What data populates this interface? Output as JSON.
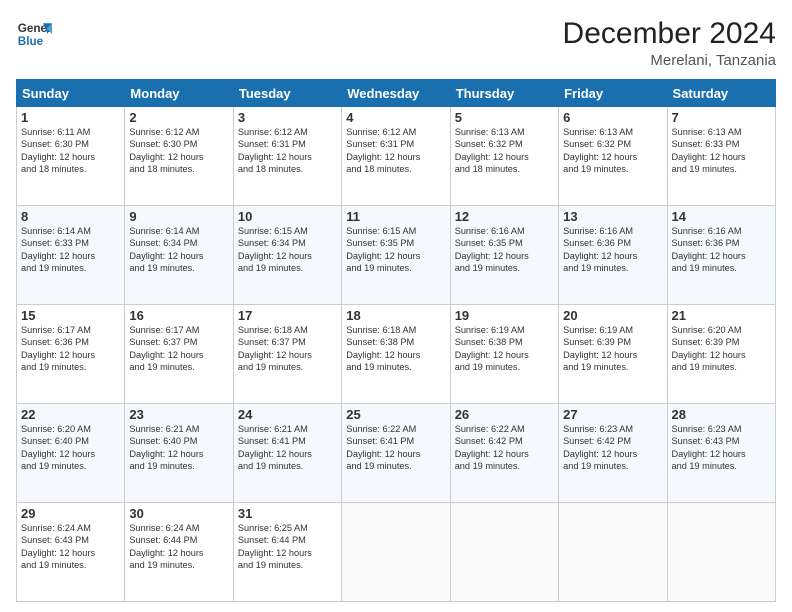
{
  "logo": {
    "line1": "General",
    "line2": "Blue"
  },
  "title": "December 2024",
  "subtitle": "Merelani, Tanzania",
  "days_header": [
    "Sunday",
    "Monday",
    "Tuesday",
    "Wednesday",
    "Thursday",
    "Friday",
    "Saturday"
  ],
  "weeks": [
    [
      {
        "day": "1",
        "sunrise": "6:11 AM",
        "sunset": "6:30 PM",
        "daylight": "12 hours and 18 minutes."
      },
      {
        "day": "2",
        "sunrise": "6:12 AM",
        "sunset": "6:30 PM",
        "daylight": "12 hours and 18 minutes."
      },
      {
        "day": "3",
        "sunrise": "6:12 AM",
        "sunset": "6:31 PM",
        "daylight": "12 hours and 18 minutes."
      },
      {
        "day": "4",
        "sunrise": "6:12 AM",
        "sunset": "6:31 PM",
        "daylight": "12 hours and 18 minutes."
      },
      {
        "day": "5",
        "sunrise": "6:13 AM",
        "sunset": "6:32 PM",
        "daylight": "12 hours and 18 minutes."
      },
      {
        "day": "6",
        "sunrise": "6:13 AM",
        "sunset": "6:32 PM",
        "daylight": "12 hours and 19 minutes."
      },
      {
        "day": "7",
        "sunrise": "6:13 AM",
        "sunset": "6:33 PM",
        "daylight": "12 hours and 19 minutes."
      }
    ],
    [
      {
        "day": "8",
        "sunrise": "6:14 AM",
        "sunset": "6:33 PM",
        "daylight": "12 hours and 19 minutes."
      },
      {
        "day": "9",
        "sunrise": "6:14 AM",
        "sunset": "6:34 PM",
        "daylight": "12 hours and 19 minutes."
      },
      {
        "day": "10",
        "sunrise": "6:15 AM",
        "sunset": "6:34 PM",
        "daylight": "12 hours and 19 minutes."
      },
      {
        "day": "11",
        "sunrise": "6:15 AM",
        "sunset": "6:35 PM",
        "daylight": "12 hours and 19 minutes."
      },
      {
        "day": "12",
        "sunrise": "6:16 AM",
        "sunset": "6:35 PM",
        "daylight": "12 hours and 19 minutes."
      },
      {
        "day": "13",
        "sunrise": "6:16 AM",
        "sunset": "6:36 PM",
        "daylight": "12 hours and 19 minutes."
      },
      {
        "day": "14",
        "sunrise": "6:16 AM",
        "sunset": "6:36 PM",
        "daylight": "12 hours and 19 minutes."
      }
    ],
    [
      {
        "day": "15",
        "sunrise": "6:17 AM",
        "sunset": "6:36 PM",
        "daylight": "12 hours and 19 minutes."
      },
      {
        "day": "16",
        "sunrise": "6:17 AM",
        "sunset": "6:37 PM",
        "daylight": "12 hours and 19 minutes."
      },
      {
        "day": "17",
        "sunrise": "6:18 AM",
        "sunset": "6:37 PM",
        "daylight": "12 hours and 19 minutes."
      },
      {
        "day": "18",
        "sunrise": "6:18 AM",
        "sunset": "6:38 PM",
        "daylight": "12 hours and 19 minutes."
      },
      {
        "day": "19",
        "sunrise": "6:19 AM",
        "sunset": "6:38 PM",
        "daylight": "12 hours and 19 minutes."
      },
      {
        "day": "20",
        "sunrise": "6:19 AM",
        "sunset": "6:39 PM",
        "daylight": "12 hours and 19 minutes."
      },
      {
        "day": "21",
        "sunrise": "6:20 AM",
        "sunset": "6:39 PM",
        "daylight": "12 hours and 19 minutes."
      }
    ],
    [
      {
        "day": "22",
        "sunrise": "6:20 AM",
        "sunset": "6:40 PM",
        "daylight": "12 hours and 19 minutes."
      },
      {
        "day": "23",
        "sunrise": "6:21 AM",
        "sunset": "6:40 PM",
        "daylight": "12 hours and 19 minutes."
      },
      {
        "day": "24",
        "sunrise": "6:21 AM",
        "sunset": "6:41 PM",
        "daylight": "12 hours and 19 minutes."
      },
      {
        "day": "25",
        "sunrise": "6:22 AM",
        "sunset": "6:41 PM",
        "daylight": "12 hours and 19 minutes."
      },
      {
        "day": "26",
        "sunrise": "6:22 AM",
        "sunset": "6:42 PM",
        "daylight": "12 hours and 19 minutes."
      },
      {
        "day": "27",
        "sunrise": "6:23 AM",
        "sunset": "6:42 PM",
        "daylight": "12 hours and 19 minutes."
      },
      {
        "day": "28",
        "sunrise": "6:23 AM",
        "sunset": "6:43 PM",
        "daylight": "12 hours and 19 minutes."
      }
    ],
    [
      {
        "day": "29",
        "sunrise": "6:24 AM",
        "sunset": "6:43 PM",
        "daylight": "12 hours and 19 minutes."
      },
      {
        "day": "30",
        "sunrise": "6:24 AM",
        "sunset": "6:44 PM",
        "daylight": "12 hours and 19 minutes."
      },
      {
        "day": "31",
        "sunrise": "6:25 AM",
        "sunset": "6:44 PM",
        "daylight": "12 hours and 19 minutes."
      },
      null,
      null,
      null,
      null
    ]
  ],
  "labels": {
    "sunrise": "Sunrise:",
    "sunset": "Sunset:",
    "daylight": "Daylight:"
  }
}
